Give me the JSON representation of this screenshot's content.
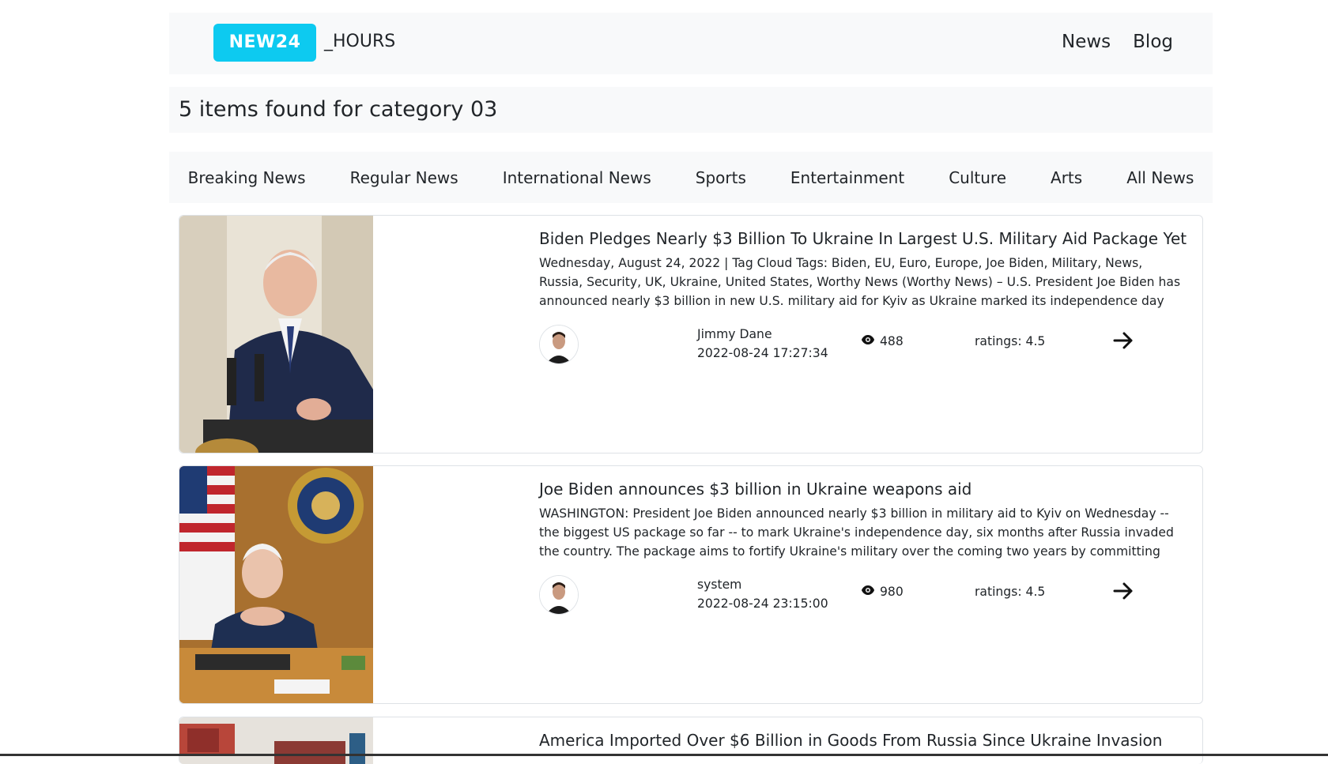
{
  "navbar": {
    "brand_badge": "NEW24",
    "brand_rest": "_HOURS",
    "links": [
      "News",
      "Blog"
    ]
  },
  "results": {
    "heading": "5 items found for category 03"
  },
  "categories": [
    "Breaking News",
    "Regular News",
    "International News",
    "Sports",
    "Entertainment",
    "Culture",
    "Arts",
    "All News"
  ],
  "articles": [
    {
      "title": "Biden Pledges Nearly $3 Billion To Ukraine In Largest U.S. Military Aid Package Yet",
      "excerpt": "Wednesday, August 24, 2022 | Tag Cloud Tags: Biden, EU, Euro, Europe, Joe Biden, Military, News, Russia, Security, UK, Ukraine, United States, Worthy News (Worthy News) – U.S. President Joe Biden has announced nearly $3 billion in new U.S. military aid for Kyiv as Ukraine marked its independence day",
      "author": "Jimmy Dane",
      "date": "2022-08-24 17:27:34",
      "views": "488",
      "rating": "ratings: 4.5"
    },
    {
      "title": "Joe Biden announces $3 billion in Ukraine weapons aid",
      "excerpt": "WASHINGTON: President Joe Biden announced nearly $3 billion in military aid to Kyiv on Wednesday -- the biggest US package so far -- to mark Ukraine's independence day, six months after Russia invaded the country. The package aims to fortify Ukraine's military over the coming two years by committing",
      "author": "system",
      "date": "2022-08-24 23:15:00",
      "views": "980",
      "rating": "ratings: 4.5"
    },
    {
      "title": "America Imported Over $6 Billion in Goods From Russia Since Ukraine Invasion"
    }
  ],
  "icons": {
    "views": "eye-icon",
    "read_more": "arrow-right-icon",
    "avatar": "user-avatar"
  },
  "colors": {
    "brand_badge": "#0dcaf0",
    "bar_bg": "#f8f9fa",
    "text": "#212529"
  }
}
